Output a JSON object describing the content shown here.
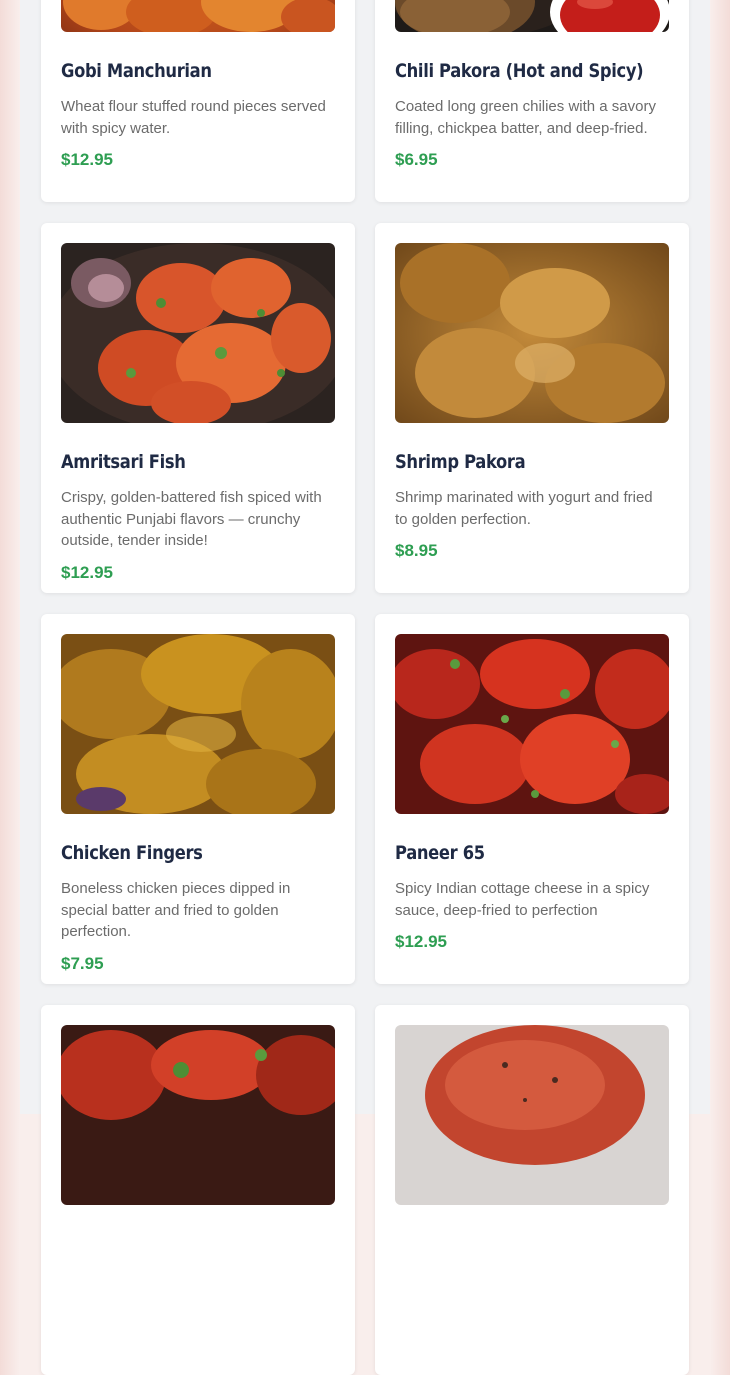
{
  "menu": {
    "items": [
      {
        "name": "Gobi Manchurian",
        "description": "Wheat flour stuffed round pieces served with spicy water.",
        "price": "$12.95",
        "image_icon": "gobi-manchurian-photo"
      },
      {
        "name": "Chili Pakora (Hot and Spicy)",
        "description": "Coated long green chilies with a savory filling, chickpea batter, and deep-fried.",
        "price": "$6.95",
        "image_icon": "chili-pakora-photo"
      },
      {
        "name": "Amritsari Fish",
        "description": "Crispy, golden-battered fish spiced with authentic Punjabi flavors — crunchy outside, tender inside!",
        "price": "$12.95",
        "image_icon": "amritsari-fish-photo"
      },
      {
        "name": "Shrimp Pakora",
        "description": "Shrimp marinated with yogurt and fried to golden perfection.",
        "price": "$8.95",
        "image_icon": "shrimp-pakora-photo"
      },
      {
        "name": "Chicken Fingers",
        "description": "Boneless chicken pieces dipped in special batter and fried to golden perfection.",
        "price": "$7.95",
        "image_icon": "chicken-fingers-photo"
      },
      {
        "name": "Paneer 65",
        "description": "Spicy Indian cottage cheese in a spicy sauce, deep-fried to perfection",
        "price": "$12.95",
        "image_icon": "paneer-65-photo"
      },
      {
        "name": "",
        "description": "",
        "price": "",
        "image_icon": "red-curry-dish-photo"
      },
      {
        "name": "",
        "description": "",
        "price": "",
        "image_icon": "tandoori-dish-photo"
      }
    ]
  },
  "colors": {
    "title": "#1f2a44",
    "description": "#6b6b6b",
    "price": "#2e9e52",
    "card_bg": "#ffffff",
    "page_bg": "#f1f2f4"
  }
}
